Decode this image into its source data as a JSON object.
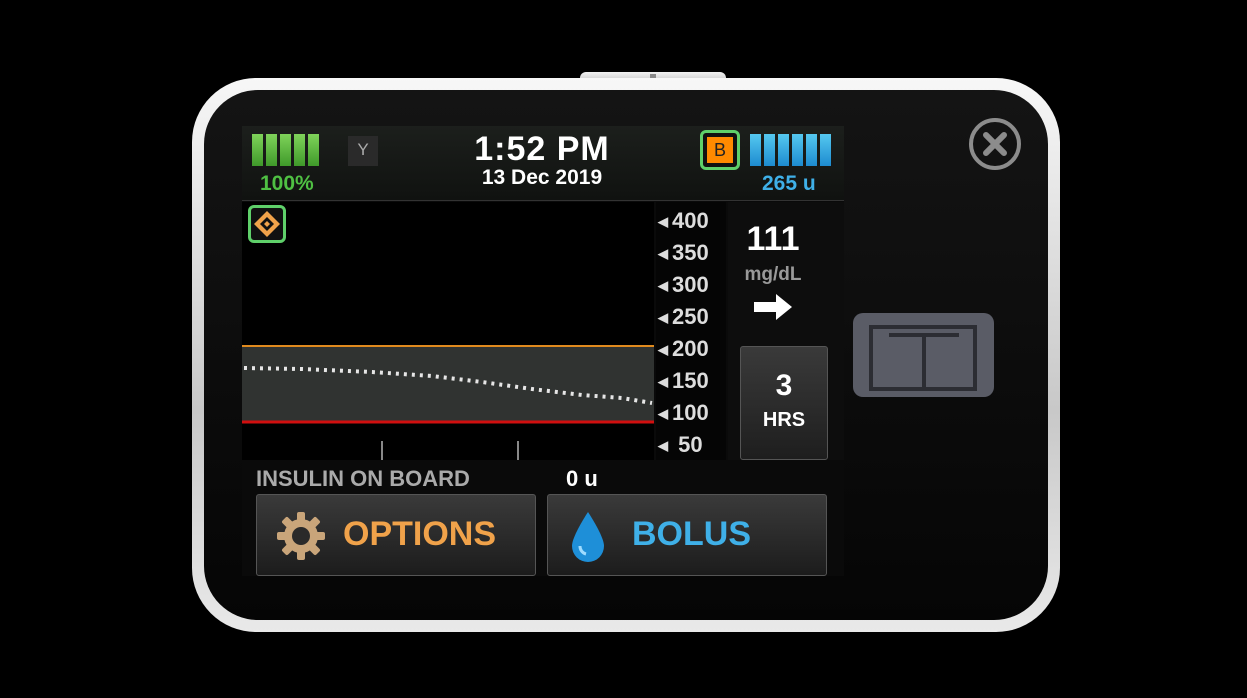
{
  "status": {
    "battery_percent": "100%",
    "time": "1:52 PM",
    "date": "13 Dec 2019",
    "basal_badge": "B",
    "insulin_units": "265 u"
  },
  "graph": {
    "axis_ticks": [
      "400",
      "350",
      "300",
      "250",
      "200",
      "150",
      "100",
      "50"
    ],
    "high_threshold_mg_dl": 200,
    "low_threshold_mg_dl": 80,
    "colors": {
      "high_line": "#e08a1e",
      "low_line": "#d10f0f",
      "target_band": "#303331",
      "trace": "#e6e6e6"
    }
  },
  "readout": {
    "glucose_value": "111",
    "glucose_unit": "mg/dL",
    "trend_icon": "right-arrow-icon",
    "range_hours": "3",
    "range_label": "HRS"
  },
  "insulin_on_board": {
    "label": "INSULIN ON BOARD",
    "value": "0 u"
  },
  "buttons": {
    "options_label": "OPTIONS",
    "options_icon": "gear-icon",
    "bolus_label": "BOLUS",
    "bolus_icon": "water-drop-icon"
  },
  "device_icons": [
    "close-icon",
    "t-logo-button"
  ]
}
